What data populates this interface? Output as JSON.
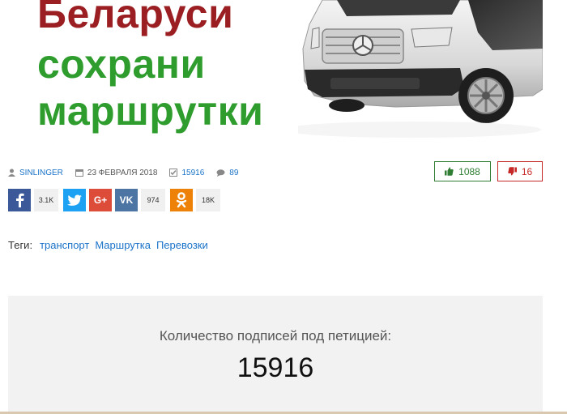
{
  "banner": {
    "line1": "Беларуси",
    "line2": "сохрани",
    "line3": "маршрутки"
  },
  "meta": {
    "author": "SINLINGER",
    "date": "23 ФЕВРАЛЯ 2018",
    "signatures": "15916",
    "comments": "89"
  },
  "votes": {
    "likes": "1088",
    "dislikes": "16"
  },
  "share": {
    "facebook_count": "3.1K",
    "vk_count": "974",
    "ok_count": "18K"
  },
  "tags": {
    "label": "Теги:",
    "items": [
      "транспорт",
      "Маршрутка",
      "Перевозки"
    ]
  },
  "petition": {
    "label": "Количество подписей под петицией:",
    "count": "15916"
  },
  "colors": {
    "link": "#1a73c8",
    "like": "#2e7d32",
    "dislike": "#c62828",
    "banner_red": "#9b1f22",
    "banner_green": "#2e9d2e"
  }
}
